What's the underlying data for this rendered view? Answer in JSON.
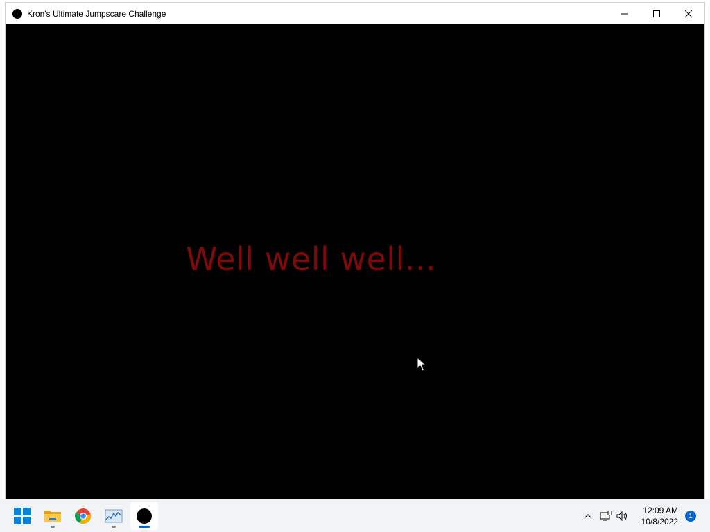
{
  "window": {
    "title": "Kron's Ultimate Jumpscare Challenge",
    "controls": {
      "minimize_icon": "minimize-icon",
      "maximize_icon": "maximize-icon",
      "close_icon": "close-icon"
    }
  },
  "game": {
    "message": "Well well well...",
    "message_color": "#7e0a0a",
    "background_color": "#000000"
  },
  "taskbar": {
    "apps": [
      {
        "name": "start",
        "icon": "windows-start-icon"
      },
      {
        "name": "file-explorer",
        "icon": "folder-icon",
        "running": true
      },
      {
        "name": "chrome",
        "icon": "chrome-icon"
      },
      {
        "name": "task-manager",
        "icon": "resource-monitor-icon",
        "running": true
      },
      {
        "name": "jumpscare-game",
        "icon": "black-circle-icon",
        "running": true,
        "active": true
      }
    ],
    "tray": {
      "chevron_icon": "chevron-up-icon",
      "network_icon": "network-icon",
      "volume_icon": "volume-icon",
      "time": "12:09 AM",
      "date": "10/8/2022",
      "notification_count": "1"
    },
    "accent_color": "#0a64c8"
  }
}
